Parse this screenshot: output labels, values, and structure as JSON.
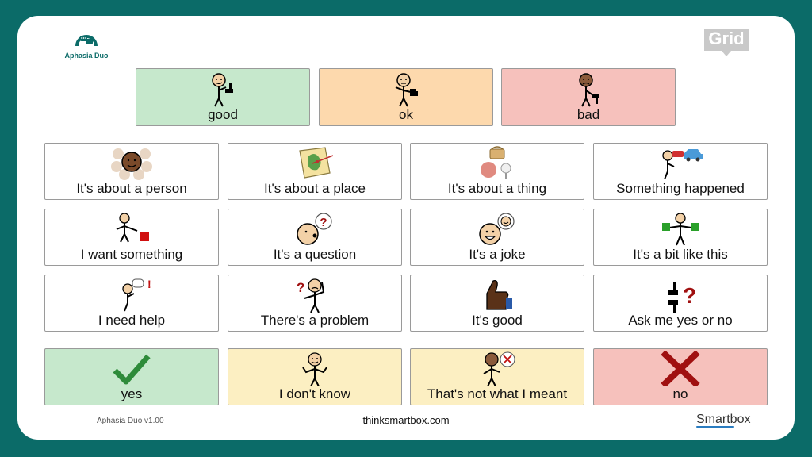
{
  "app": {
    "logo_text": "Aphasia Duo",
    "grid_badge": "Grid",
    "version": "Aphasia Duo v1.00",
    "website": "thinksmartbox.com",
    "brand": "Smartbox"
  },
  "colors": {
    "frame": "#0b6b68",
    "green_cell": "#c6e8cc",
    "orange_cell": "#fdd9ad",
    "red_cell": "#f6c1bc",
    "yellow_cell": "#fcefc2",
    "white_cell": "#ffffff"
  },
  "rating_row": [
    {
      "label": "good",
      "icon": "thumbs-up-person-icon"
    },
    {
      "label": "ok",
      "icon": "thumbs-sideways-person-icon"
    },
    {
      "label": "bad",
      "icon": "thumbs-down-person-icon"
    }
  ],
  "topics": [
    {
      "label": "It's about a person",
      "icon": "group-of-people-icon"
    },
    {
      "label": "It's about a place",
      "icon": "map-icon"
    },
    {
      "label": "It's about a thing",
      "icon": "objects-icon"
    },
    {
      "label": "Something happened",
      "icon": "car-crash-icon"
    },
    {
      "label": "I want something",
      "icon": "person-pointing-icon"
    },
    {
      "label": "It's a question",
      "icon": "question-speech-icon"
    },
    {
      "label": "It's a joke",
      "icon": "laughing-face-icon"
    },
    {
      "label": "It's a bit like this",
      "icon": "person-holding-cards-icon"
    },
    {
      "label": "I need help",
      "icon": "person-help-icon"
    },
    {
      "label": "There's a problem",
      "icon": "confused-person-icon"
    },
    {
      "label": "It's good",
      "icon": "thumbs-up-hand-icon"
    },
    {
      "label": "Ask me yes or no",
      "icon": "thumbs-question-icon"
    }
  ],
  "answers": [
    {
      "label": "yes",
      "icon": "check-mark-icon"
    },
    {
      "label": "I don't know",
      "icon": "shrugging-person-icon"
    },
    {
      "label": "That's not what I meant",
      "icon": "person-wrong-icon"
    },
    {
      "label": "no",
      "icon": "cross-mark-icon"
    }
  ]
}
